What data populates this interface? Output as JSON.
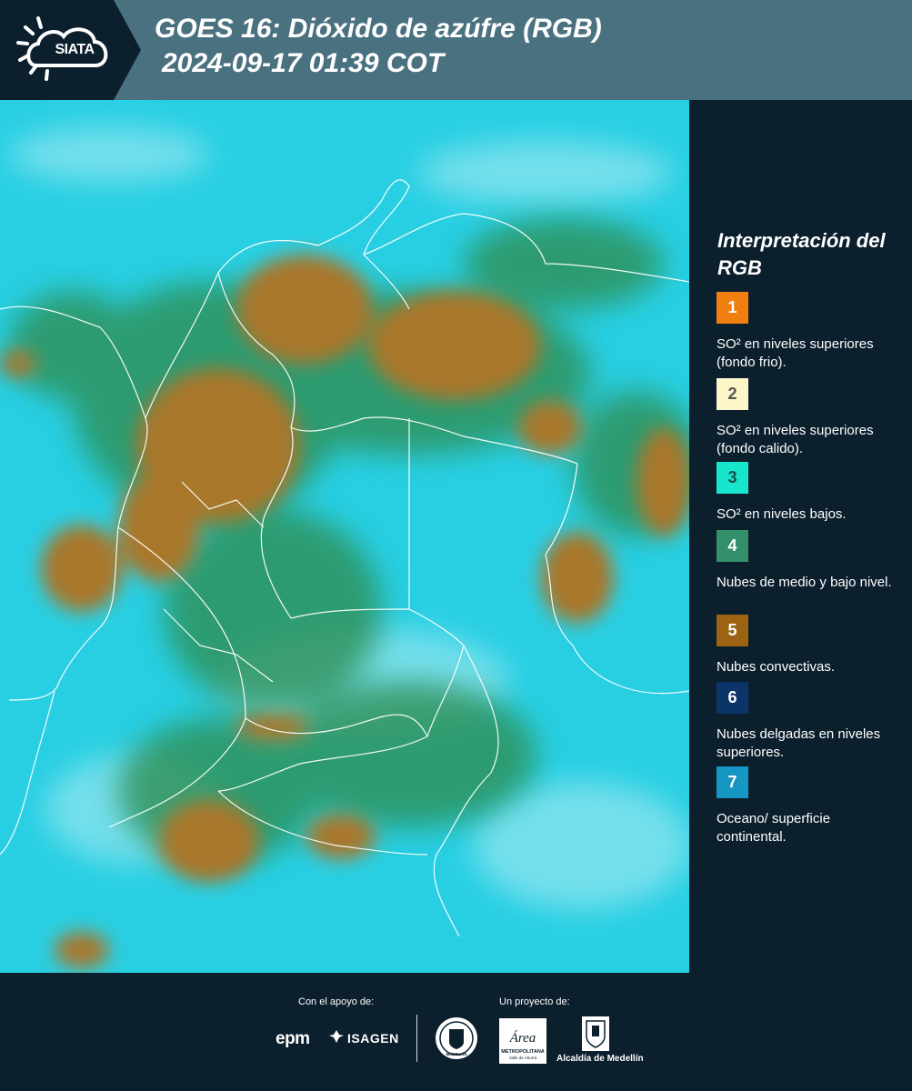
{
  "header": {
    "logo_text": "SIATA",
    "title": "GOES 16: Dióxido de azúfre (RGB)",
    "subtitle": "2024-09-17 01:39 COT"
  },
  "legend": {
    "title": "Interpretación del RGB",
    "items": [
      {
        "number": "1",
        "color": "#f07f0f",
        "text_color": "#ffffff",
        "label": "SO² en niveles superiores (fondo frio)."
      },
      {
        "number": "2",
        "color": "#fdf6c8",
        "text_color": "#555555",
        "label": "SO² en niveles superiores (fondo calido)."
      },
      {
        "number": "3",
        "color": "#18e6cc",
        "text_color": "#1a4a4a",
        "label": "SO² en niveles bajos."
      },
      {
        "number": "4",
        "color": "#33906a",
        "text_color": "#ffffff",
        "label": "Nubes de medio y bajo nivel."
      },
      {
        "number": "5",
        "color": "#9c6412",
        "text_color": "#ffffff",
        "label": "Nubes convectivas."
      },
      {
        "number": "6",
        "color": "#0b3468",
        "text_color": "#ffffff",
        "label": "Nubes delgadas en niveles superiores."
      },
      {
        "number": "7",
        "color": "#1696c2",
        "text_color": "#ffffff",
        "label": "Oceano/ superficie continental."
      }
    ]
  },
  "footer": {
    "support_label": "Con el apoyo de:",
    "project_label": "Un proyecto de:",
    "epm": "epm",
    "isagen": "ISAGEN",
    "alcaldia": "Alcaldía de Medellín",
    "area_name": "Área",
    "area_sub": "METROPOLITANA",
    "area_sub2": "Valle de Aburrá",
    "seal_text": "MEDELLÍN"
  }
}
